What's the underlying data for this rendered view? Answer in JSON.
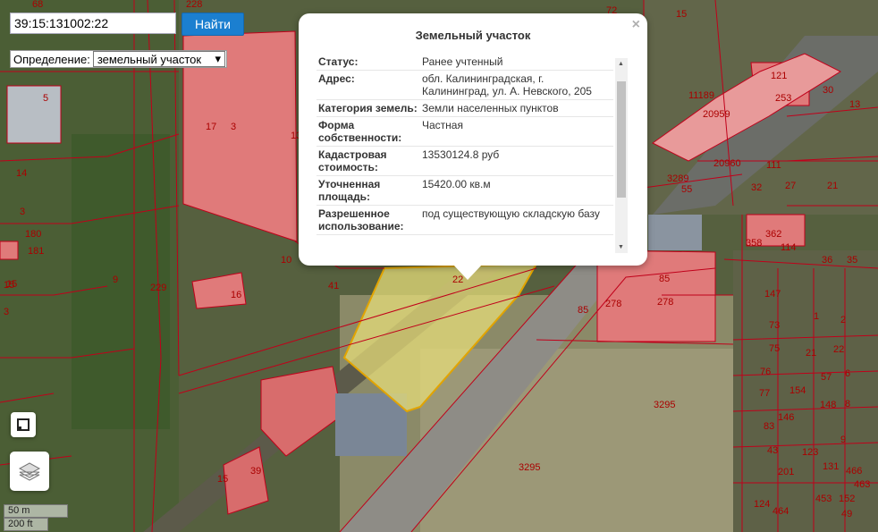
{
  "search": {
    "value": "39:15:131002:22",
    "button": "Найти"
  },
  "definition": {
    "label": "Определение:",
    "selected": "земельный участок"
  },
  "popup": {
    "title": "Земельный участок",
    "close_icon": "close-icon",
    "rows": [
      {
        "key": "Статус:",
        "value": "Ранее учтенный"
      },
      {
        "key": "Адрес:",
        "value": "обл. Калининградская, г. Калининград, ул. А. Невского, 205"
      },
      {
        "key": "Категория земель:",
        "value": "Земли населенных пунктов"
      },
      {
        "key": "Форма собственности:",
        "value": "Частная"
      },
      {
        "key": "Кадастровая стоимость:",
        "value": "13530124.8 руб"
      },
      {
        "key": "Уточненная площадь:",
        "value": "15420.00 кв.м"
      },
      {
        "key": "Разрешенное использование:",
        "value": "под существующую складскую базу"
      }
    ]
  },
  "scale": {
    "metric": "50 m",
    "imperial": "200 ft"
  },
  "map_labels": [
    "68",
    "228",
    "13",
    "15",
    "17",
    "3",
    "5",
    "14",
    "3",
    "180",
    "181",
    "15",
    "3",
    "9",
    "229",
    "41",
    "10",
    "16",
    "22",
    "85",
    "278",
    "278",
    "85",
    "3295",
    "3295",
    "15",
    "39",
    "121",
    "253",
    "11189",
    "20959",
    "20960",
    "111",
    "32",
    "27",
    "21",
    "3289",
    "55",
    "358",
    "362",
    "114",
    "36",
    "35",
    "147",
    "1",
    "2",
    "73",
    "75",
    "21",
    "22",
    "76",
    "57",
    "6",
    "77",
    "154",
    "148",
    "8",
    "146",
    "83",
    "123",
    "9",
    "43",
    "201",
    "131",
    "466",
    "463",
    "124",
    "464",
    "453",
    "152",
    "49",
    "30",
    "13",
    "72",
    "15"
  ],
  "colors": {
    "parcel_fill": "#e07a7a",
    "selected_fill": "#e6dc7a",
    "boundary": "#c0001a",
    "accent": "#1b7fd0"
  }
}
